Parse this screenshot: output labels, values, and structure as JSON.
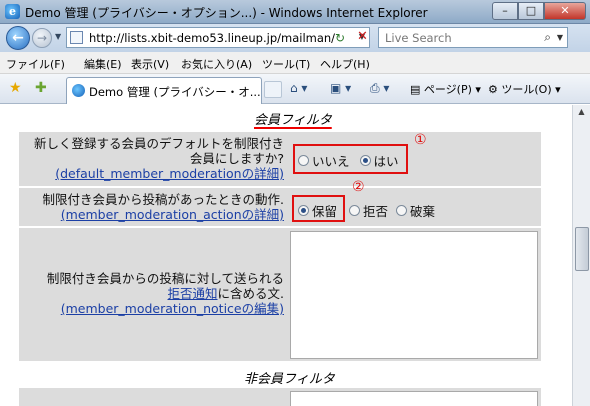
{
  "window": {
    "title": "Demo 管理 (プライバシー・オプション...) - Windows Internet Explorer"
  },
  "address": {
    "url": "http://lists.xbit-demo53.lineup.jp/mailman/",
    "search_placeholder": "Live Search"
  },
  "menu": [
    "ファイル(F)",
    "編集(E)",
    "表示(V)",
    "お気に入り(A)",
    "ツール(T)",
    "ヘルプ(H)"
  ],
  "tab": {
    "label": "Demo 管理 (プライバシー・オ..."
  },
  "commands": {
    "page": "ページ(P)",
    "tools": "ツール(O)"
  },
  "content": {
    "section1_title": "会員フィルタ",
    "section2_title": "非会員フィルタ",
    "row1": {
      "label_line1": "新しく登録する会員のデフォルトを制限付き",
      "label_line2": "会員にしますか?",
      "link": "(default_member_moderationの詳細)",
      "options": [
        "いいえ",
        "はい"
      ],
      "selected": "はい",
      "marker": "①"
    },
    "row2": {
      "label_line1": "制限付き会員から投稿があったときの動作.",
      "link": "(member_moderation_actionの詳細)",
      "options": [
        "保留",
        "拒否",
        "破棄"
      ],
      "selected": "保留",
      "marker": "②"
    },
    "row3": {
      "label_line1": "制限付き会員からの投稿に対して送られる",
      "link_inline": "拒否通知",
      "label_tail": "に含める文.",
      "link": "(member_moderation_noticeの編集)"
    }
  },
  "colors": {
    "highlight": "#e01010",
    "link": "#1b3fa5",
    "row_bg": "#dcdcdc"
  }
}
